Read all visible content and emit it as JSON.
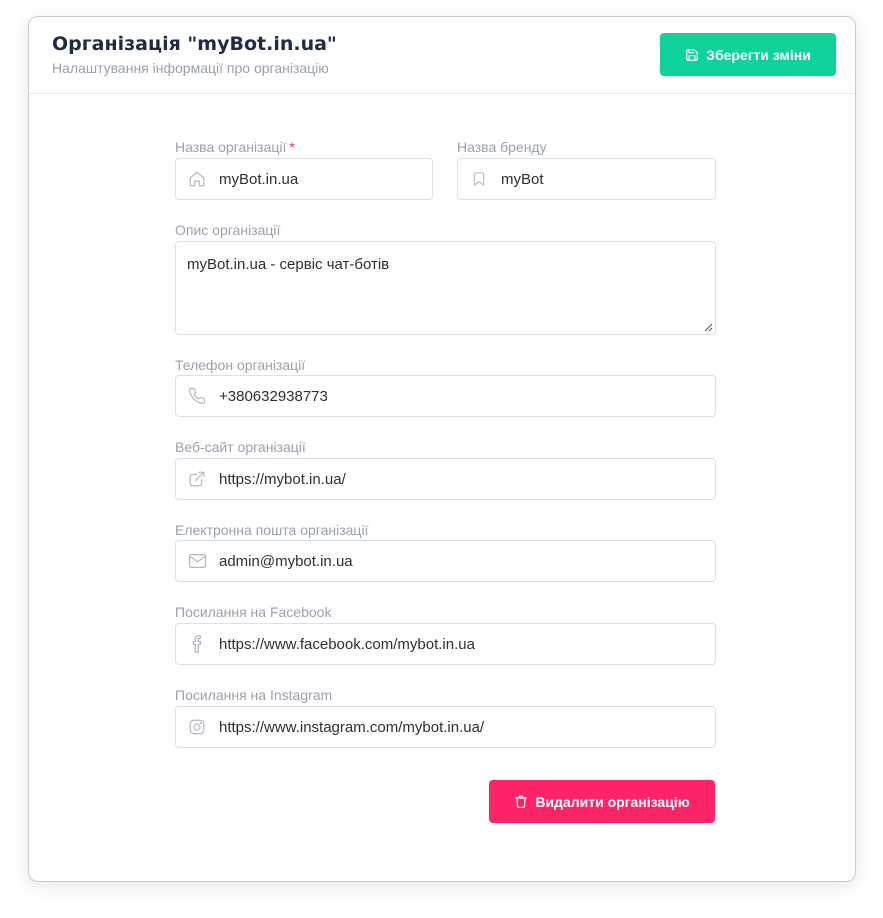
{
  "header": {
    "title": "Організація \"myBot.in.ua\"",
    "subtitle": "Налаштування інформації про організацію",
    "save_label": "Зберегти зміни"
  },
  "colors": {
    "save": "#0fd39a",
    "delete": "#ff2368",
    "required": "#e53950"
  },
  "form": {
    "org_name": {
      "label": "Назва організації",
      "required_mark": "*",
      "value": "myBot.in.ua",
      "icon": "home-icon"
    },
    "brand_name": {
      "label": "Назва бренду",
      "value": "myBot",
      "icon": "bookmark-icon"
    },
    "description": {
      "label": "Опис організації",
      "value": "myBot.in.ua - сервіс чат-ботів"
    },
    "phone": {
      "label": "Телефон організації",
      "value": "+380632938773",
      "icon": "phone-icon"
    },
    "website": {
      "label": "Веб-сайт організації",
      "value": "https://mybot.in.ua/",
      "icon": "external-link-icon"
    },
    "email": {
      "label": "Електронна пошта організації",
      "value": "admin@mybot.in.ua",
      "icon": "mail-icon"
    },
    "facebook": {
      "label": "Посилання на Facebook",
      "value": "https://www.facebook.com/mybot.in.ua",
      "icon": "facebook-icon"
    },
    "instagram": {
      "label": "Посилання на Instagram",
      "value": "https://www.instagram.com/mybot.in.ua/",
      "icon": "instagram-icon"
    }
  },
  "actions": {
    "delete_label": "Видалити організацію"
  }
}
